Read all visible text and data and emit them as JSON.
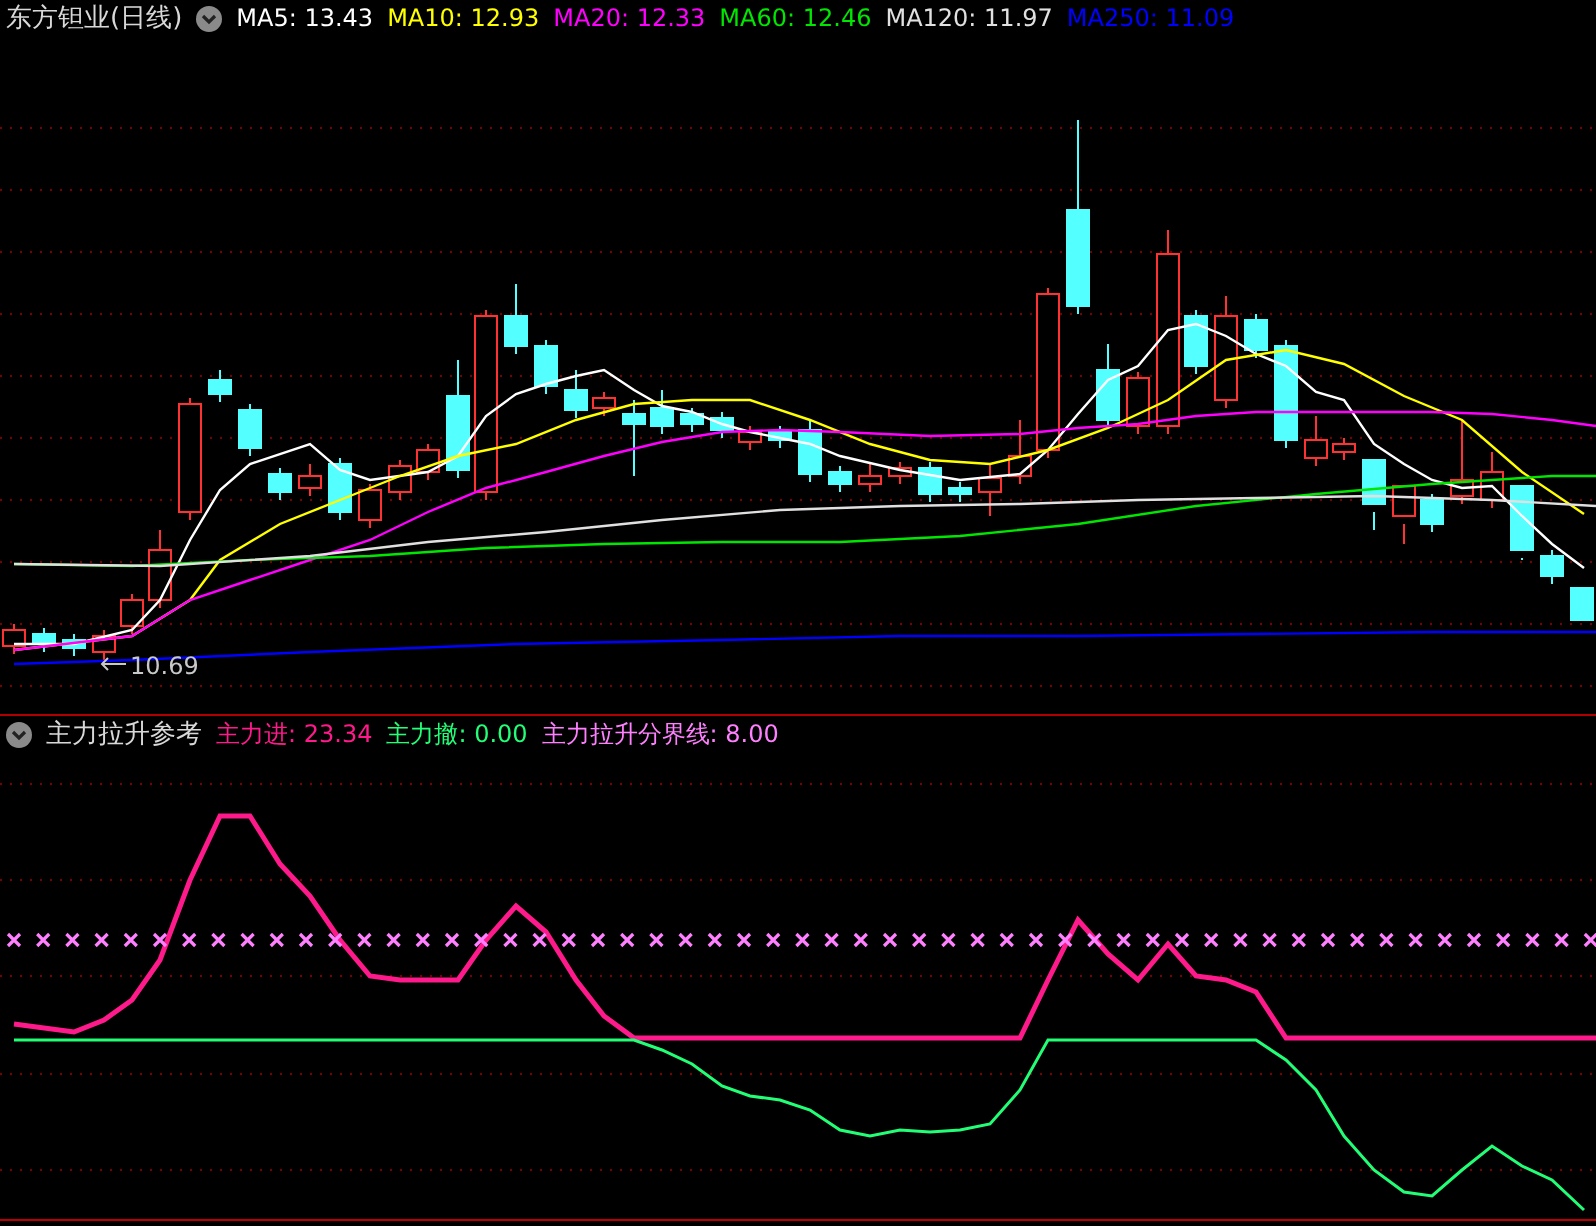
{
  "main_panel": {
    "title": "东方钽业(日线)",
    "legend": [
      {
        "label": "MA5: 13.43",
        "color": "#ffffff"
      },
      {
        "label": "MA10: 12.93",
        "color": "#ffff00"
      },
      {
        "label": "MA20: 12.33",
        "color": "#ff00ff"
      },
      {
        "label": "MA60: 12.46",
        "color": "#00e600"
      },
      {
        "label": "MA120: 11.97",
        "color": "#e0e0e0"
      },
      {
        "label": "MA250: 11.09",
        "color": "#0000ff"
      }
    ],
    "low_marker": "10.69"
  },
  "indicator_panel": {
    "title": "主力拉升参考",
    "legend": [
      {
        "label": "主力进: 23.34",
        "color": "#ff1a8c"
      },
      {
        "label": "主力撤: 0.00",
        "color": "#22ff77"
      },
      {
        "label": "主力拉升分界线: 8.00",
        "color": "#ff80ff"
      }
    ]
  }
}
